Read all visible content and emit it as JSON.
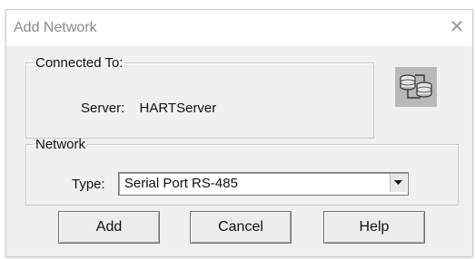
{
  "window": {
    "title": "Add Network",
    "close_symbol": "✕"
  },
  "connected_group": {
    "legend": "Connected To:",
    "server_label": "Server:",
    "server_value": "HARTServer"
  },
  "network_group": {
    "legend": "Network",
    "type_label": "Type:",
    "type_value": "Serial Port RS-485"
  },
  "icon": "network-nodes-icon",
  "buttons": {
    "add": "Add",
    "cancel": "Cancel",
    "help": "Help"
  }
}
